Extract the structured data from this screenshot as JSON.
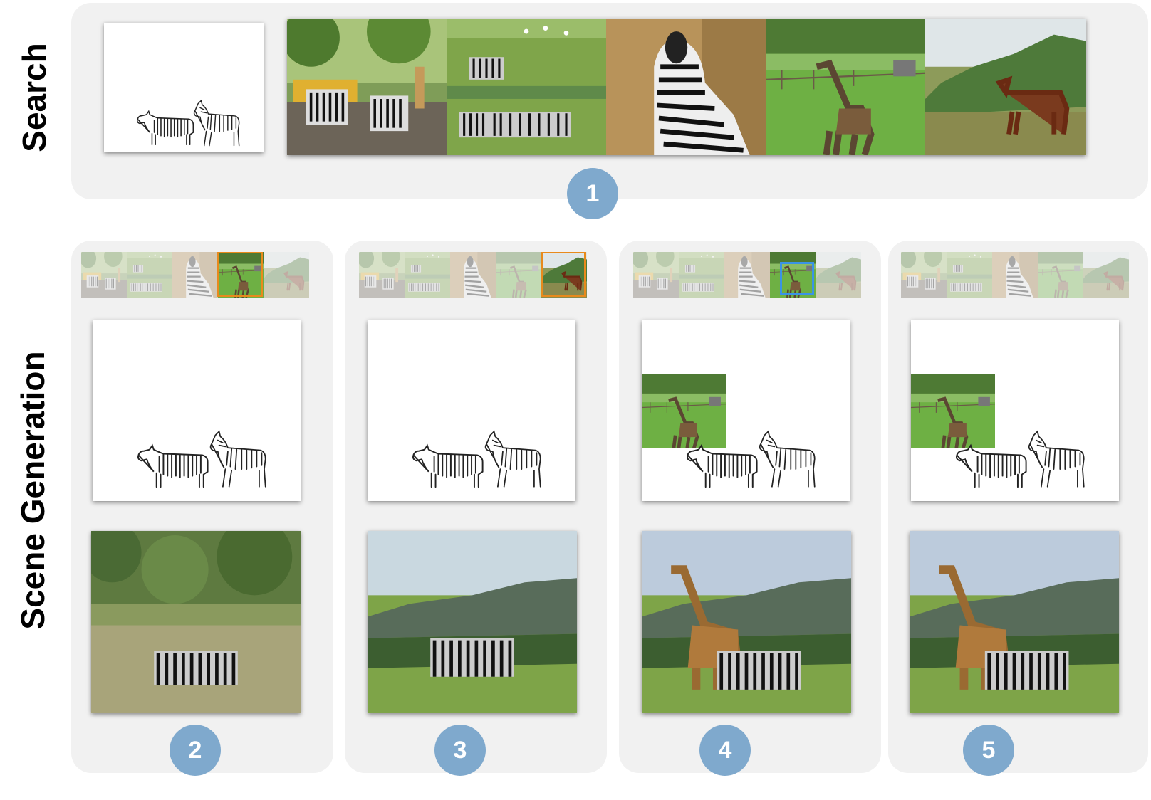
{
  "labels": {
    "search": "Search",
    "scene_generation": "Scene Generation"
  },
  "steps": [
    "1",
    "2",
    "3",
    "4",
    "5"
  ],
  "colors": {
    "panel_bg": "#f1f1f1",
    "badge": "#7fa9cd",
    "highlight_selected": "#e88a1c",
    "highlight_placed": "#3a93e6"
  },
  "search_results": [
    "zebras-giraffes-zoo",
    "zebra-herd-grassland",
    "zebra-portrait",
    "giraffe-field",
    "horse-hills"
  ],
  "stages": [
    {
      "step": "2",
      "selected": "giraffe-field",
      "highlight": "orange",
      "output": "zebras-in-bush"
    },
    {
      "step": "3",
      "selected": "horse-hills",
      "highlight": "orange",
      "output": "zebras-in-valley"
    },
    {
      "step": "4",
      "selected": "giraffe-field",
      "highlight": "blue",
      "output": "giraffe-and-zebras-valley"
    },
    {
      "step": "5",
      "selected": "",
      "highlight": "",
      "output": "giraffe-and-zebras-valley-2"
    }
  ]
}
